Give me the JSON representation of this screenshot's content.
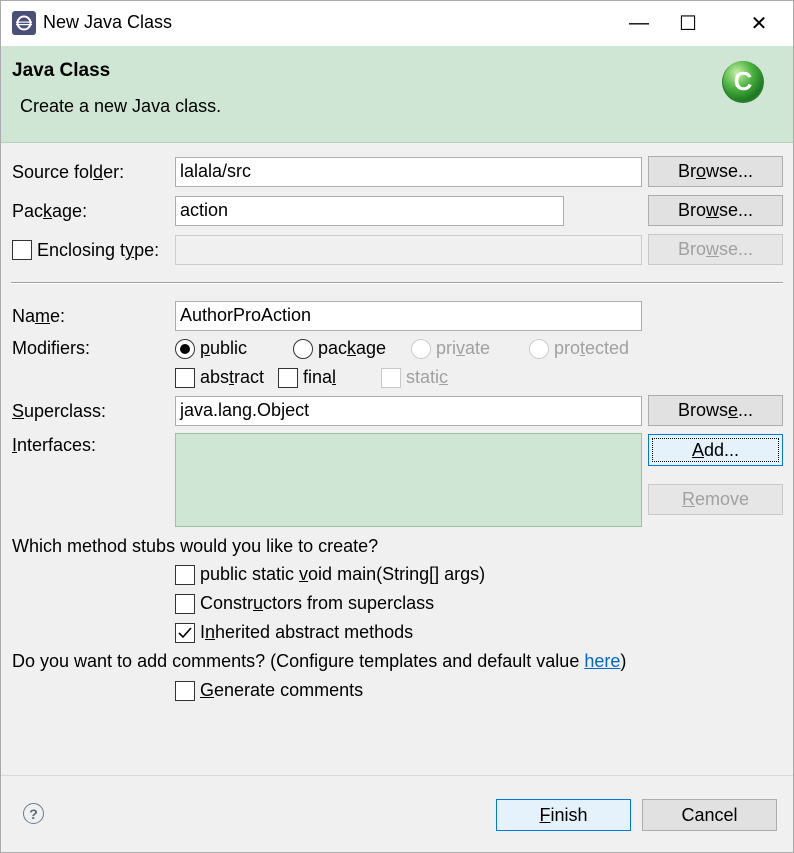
{
  "window": {
    "title": "New Java Class",
    "controls": {
      "minimize": "—",
      "maximize": "☐",
      "close": "✕"
    }
  },
  "header": {
    "title": "Java Class",
    "description": "Create a new Java class.",
    "logo_letter": "C"
  },
  "source_folder": {
    "label_pre": "Source fol",
    "label_mn": "d",
    "label_post": "er:",
    "value": "lalala/src",
    "browse": {
      "pre": "Br",
      "mn": "o",
      "post": "wse..."
    }
  },
  "package": {
    "label_pre": "Pac",
    "label_mn": "k",
    "label_post": "age:",
    "value": "action",
    "browse": {
      "pre": "Bro",
      "mn": "w",
      "post": "se..."
    }
  },
  "enclosing_type": {
    "checked": false,
    "label_pre": "Enclosing t",
    "label_mn": "y",
    "label_post": "pe:",
    "value": "",
    "browse": {
      "pre": "Bro",
      "mn": "w",
      "post": "se..."
    }
  },
  "name": {
    "label_pre": "Na",
    "label_mn": "m",
    "label_post": "e:",
    "value": "AuthorProAction"
  },
  "modifiers": {
    "label": "Modifiers:",
    "radios": [
      {
        "pre": "",
        "mn": "p",
        "post": "ublic",
        "selected": true,
        "enabled": true
      },
      {
        "pre": "pac",
        "mn": "k",
        "post": "age",
        "selected": false,
        "enabled": true
      },
      {
        "pre": "pri",
        "mn": "v",
        "post": "ate",
        "selected": false,
        "enabled": false
      },
      {
        "pre": "pro",
        "mn": "t",
        "post": "ected",
        "selected": false,
        "enabled": false
      }
    ],
    "checks": [
      {
        "pre": "abs",
        "mn": "t",
        "post": "ract",
        "checked": false,
        "enabled": true
      },
      {
        "pre": "fina",
        "mn": "l",
        "post": "",
        "checked": false,
        "enabled": true
      },
      {
        "pre": "stati",
        "mn": "c",
        "post": "",
        "checked": false,
        "enabled": false
      }
    ]
  },
  "superclass": {
    "label_pre": "",
    "label_mn": "S",
    "label_post": "uperclass:",
    "value": "java.lang.Object",
    "browse": {
      "pre": "Brows",
      "mn": "e",
      "post": "..."
    }
  },
  "interfaces": {
    "label_pre": "",
    "label_mn": "I",
    "label_post": "nterfaces:",
    "add": {
      "pre": "",
      "mn": "A",
      "post": "dd..."
    },
    "remove": {
      "pre": "",
      "mn": "R",
      "post": "emove"
    }
  },
  "stubs": {
    "question": "Which method stubs would you like to create?",
    "options": [
      {
        "pre": "public static ",
        "mn": "v",
        "post": "oid main(String[] args)",
        "checked": false
      },
      {
        "pre": "Constr",
        "mn": "u",
        "post": "ctors from superclass",
        "checked": false
      },
      {
        "pre": "I",
        "mn": "n",
        "post": "herited abstract methods",
        "checked": true
      }
    ]
  },
  "comments": {
    "question": "Do you want to add comments? (Configure templates and default value ",
    "link": "here",
    "question_end": ")",
    "option": {
      "pre": "",
      "mn": "G",
      "post": "enerate comments",
      "checked": false
    }
  },
  "footer": {
    "help": "?",
    "finish": {
      "pre": "",
      "mn": "F",
      "post": "inish"
    },
    "cancel": "Cancel"
  },
  "colors": {
    "header_bg": "#cfe6d4",
    "logo_green": "#3ea83a",
    "link": "#0066cc"
  }
}
